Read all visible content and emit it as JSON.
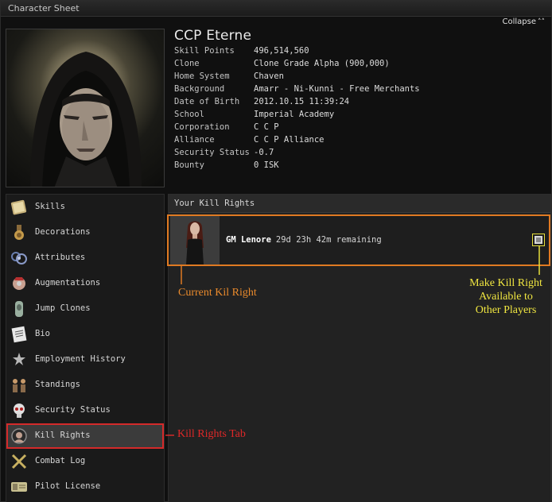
{
  "window": {
    "title": "Character Sheet",
    "collapse_label": "Collapse"
  },
  "character": {
    "name": "CCP Eterne",
    "fields": [
      {
        "label": "Skill Points",
        "value": "496,514,560"
      },
      {
        "label": "Clone",
        "value": "Clone Grade Alpha (900,000)"
      },
      {
        "label": "Home System",
        "value": "Chaven"
      },
      {
        "label": "Background",
        "value": "Amarr - Ni-Kunni - Free Merchants"
      },
      {
        "label": "Date of Birth",
        "value": "2012.10.15 11:39:24"
      },
      {
        "label": "School",
        "value": "Imperial Academy"
      },
      {
        "label": "Corporation",
        "value": "C C P"
      },
      {
        "label": "Alliance",
        "value": "C C P Alliance"
      },
      {
        "label": "Security Status",
        "value": "-0.7"
      },
      {
        "label": "Bounty",
        "value": "0 ISK"
      }
    ]
  },
  "sidebar": {
    "items": [
      {
        "label": "Skills",
        "icon": "skills-book-icon"
      },
      {
        "label": "Decorations",
        "icon": "decorations-medal-icon"
      },
      {
        "label": "Attributes",
        "icon": "attributes-icon"
      },
      {
        "label": "Augmentations",
        "icon": "augmentations-icon"
      },
      {
        "label": "Jump Clones",
        "icon": "jump-clones-icon"
      },
      {
        "label": "Bio",
        "icon": "bio-document-icon"
      },
      {
        "label": "Employment History",
        "icon": "employment-history-icon"
      },
      {
        "label": "Standings",
        "icon": "standings-icon"
      },
      {
        "label": "Security Status",
        "icon": "security-status-skull-icon"
      },
      {
        "label": "Kill Rights",
        "icon": "kill-rights-icon"
      },
      {
        "label": "Combat Log",
        "icon": "combat-log-swords-icon"
      },
      {
        "label": "Pilot License",
        "icon": "pilot-license-icon"
      }
    ],
    "active": "Kill Rights"
  },
  "kill_rights": {
    "header": "Your Kill Rights",
    "entry": {
      "name": "GM Lenore",
      "time": "29d 23h 42m remaining"
    }
  },
  "annotations": {
    "current": "Current Kil Right",
    "tab": "Kill Rights Tab",
    "make_available_1": "Make Kill Right",
    "make_available_2": "Available to",
    "make_available_3": "Other Players"
  },
  "colors": {
    "annot_orange": "#e98a2c",
    "annot_red": "#e02828",
    "annot_yellow": "#f0e640"
  }
}
